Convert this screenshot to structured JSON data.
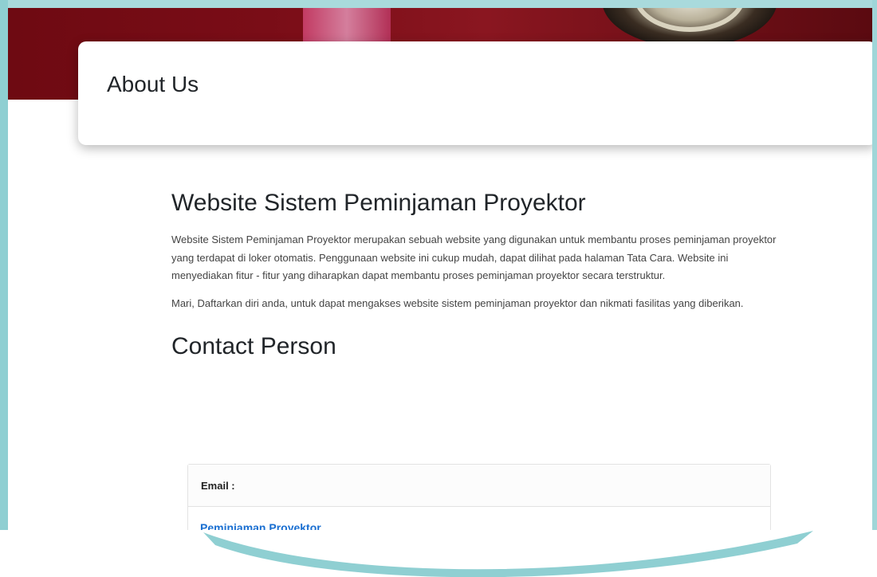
{
  "header": {
    "title": "About Us"
  },
  "main": {
    "heading": "Website Sistem Peminjaman Proyektor",
    "paragraphs": [
      "Website Sistem Peminjaman Proyektor merupakan sebuah website yang digunakan untuk membantu proses peminjaman proyektor yang terdapat di loker otomatis. Penggunaan website ini cukup mudah, dapat dilihat pada halaman Tata Cara. Website ini menyediakan fitur - fitur yang diharapkan dapat membantu proses peminjaman proyektor secara terstruktur.",
      "Mari, Daftarkan diri anda, untuk dapat mengakses website sistem peminjaman proyektor dan nikmati fasilitas yang diberikan."
    ],
    "contact_heading": "Contact Person",
    "contact": {
      "label": "Email :",
      "link_text": "Peminjaman Proyektor"
    }
  },
  "colors": {
    "banner": "#7a0d17",
    "watermark": "#8fcfd2",
    "link": "#1a6fd1"
  }
}
